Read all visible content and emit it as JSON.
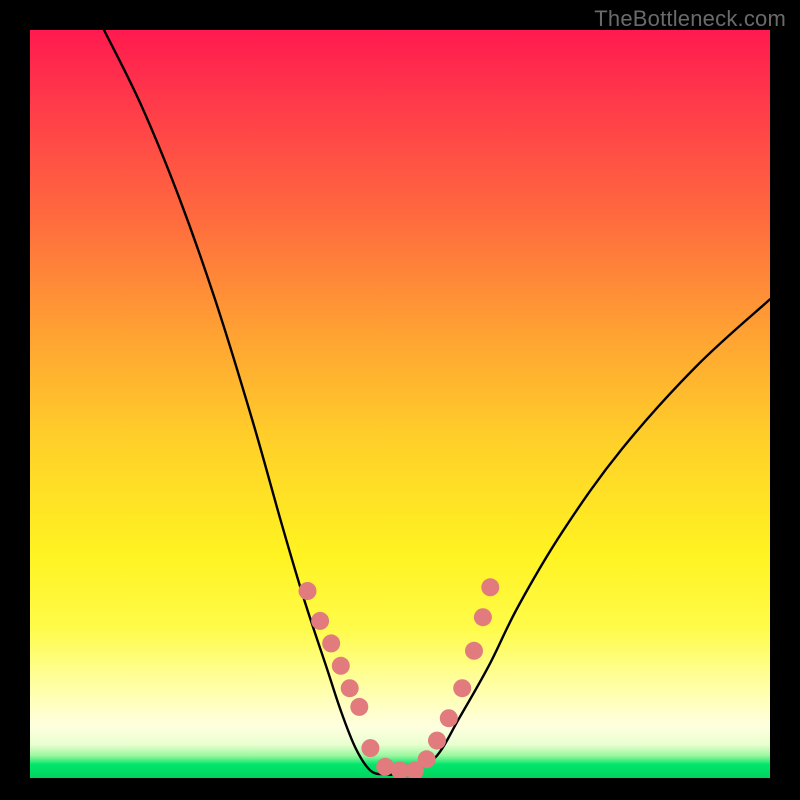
{
  "watermark": "TheBottleneck.com",
  "chart_data": {
    "type": "line",
    "title": "",
    "xlabel": "",
    "ylabel": "",
    "xlim": [
      0,
      100
    ],
    "ylim": [
      0,
      100
    ],
    "series": [
      {
        "name": "bottleneck-curve",
        "x": [
          10,
          15,
          20,
          25,
          30,
          34,
          37,
          40,
          42,
          44,
          46,
          48,
          50,
          52,
          55,
          58,
          62,
          66,
          72,
          80,
          90,
          100
        ],
        "values": [
          100,
          90,
          78,
          64,
          48,
          34,
          24,
          15,
          9,
          4,
          1,
          0.5,
          0.5,
          1,
          3,
          8,
          15,
          23,
          33,
          44,
          55,
          64
        ]
      }
    ],
    "markers": {
      "name": "highlight-dots",
      "x_approx": [
        37.5,
        39.2,
        40.7,
        42.0,
        43.2,
        44.5,
        46.0,
        48.0,
        50.0,
        52.0,
        53.6,
        55.0,
        56.6,
        58.4,
        60.0,
        61.2,
        62.2
      ],
      "value_approx": [
        25.0,
        21.0,
        18.0,
        15.0,
        12.0,
        9.5,
        4.0,
        1.5,
        1.0,
        1.0,
        2.5,
        5.0,
        8.0,
        12.0,
        17.0,
        21.5,
        25.5
      ]
    },
    "background_gradient": {
      "top": "#ff1a4f",
      "mid": "#fff321",
      "bottom": "#00d45f"
    }
  }
}
